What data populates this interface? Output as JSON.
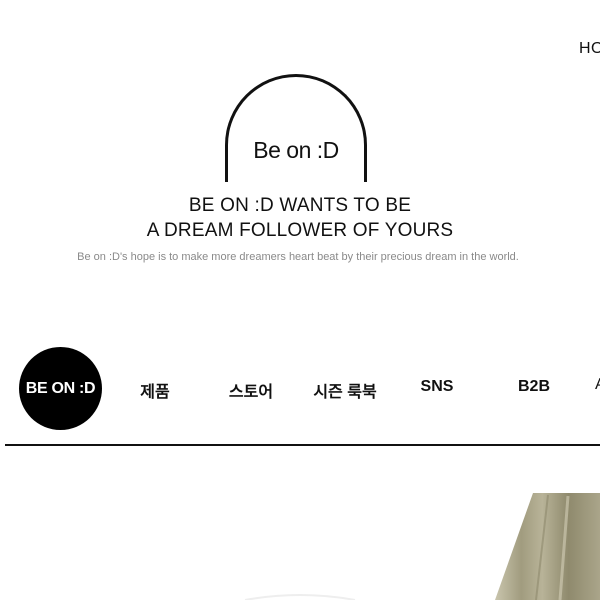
{
  "header": {
    "home_link": "HO"
  },
  "brand": {
    "logo_text": "Be on :D",
    "tagline_line1": "BE ON :D WANTS TO BE",
    "tagline_line2": "A DREAM FOLLOWER OF YOURS",
    "subline": "Be on :D's hope is to make more dreamers heart beat by their precious dream in the world."
  },
  "nav": {
    "logo_label": "BE ON :D",
    "items": [
      {
        "label": "제품"
      },
      {
        "label": "스토어"
      },
      {
        "label": "시즌 룩북"
      },
      {
        "label": "SNS"
      },
      {
        "label": "B2B"
      }
    ],
    "partial_item": "Α"
  },
  "colors": {
    "text": "#111111",
    "muted": "#8a8a8a",
    "hero_fabric": "#9f9a7c"
  }
}
